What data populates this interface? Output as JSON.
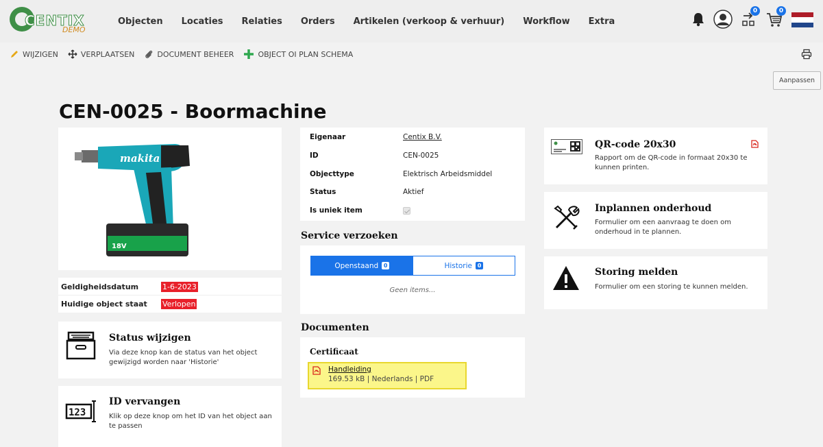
{
  "nav": {
    "logo_text": "CENTIX",
    "logo_sub": "DEMO",
    "menu": [
      "Objecten",
      "Locaties",
      "Relaties",
      "Orders",
      "Artikelen (verkoop & verhuur)",
      "Workflow",
      "Extra"
    ],
    "scan_count": "0",
    "cart_count": "0"
  },
  "toolbar": {
    "edit": "WIJZIGEN",
    "move": "VERPLAATSEN",
    "docs": "DOCUMENT BEHEER",
    "plan": "OBJECT OI PLAN SCHEMA",
    "customize": "Aanpassen"
  },
  "object": {
    "title": "CEN-0025 - Boormachine",
    "photo_brand": "makita",
    "battery_label": "18V",
    "properties": [
      {
        "label": "Eigenaar",
        "value": "Centix B.V."
      },
      {
        "label": "ID",
        "value": "CEN-0025"
      },
      {
        "label": "Objecttype",
        "value": "Elektrisch Arbeidsmiddel"
      },
      {
        "label": "Status",
        "value": "Aktief"
      },
      {
        "label": "Is uniek item",
        "value": ""
      }
    ],
    "validity": [
      {
        "label": "Geldigheidsdatum",
        "value": "1-6-2023"
      },
      {
        "label": "Huidige object staat",
        "value": "Verlopen"
      }
    ]
  },
  "actions": {
    "status_change": {
      "title": "Status wijzigen",
      "desc": "Via deze knop kan de status van het object gewijzigd worden naar 'Historie'"
    },
    "id_replace": {
      "title": "ID vervangen",
      "desc": "Klik op deze knop om het ID van het object aan te passen",
      "icon_text": "123"
    },
    "qr": {
      "title": "QR-code 20x30",
      "desc": "Rapport om de QR-code in formaat 20x30 te kunnen printen."
    },
    "maintenance": {
      "title": "Inplannen onderhoud",
      "desc": "Formulier om een aanvraag te doen om onderhoud in te plannen."
    },
    "fault": {
      "title": "Storing melden",
      "desc": "Formulier om een storing te kunnen melden."
    }
  },
  "service": {
    "heading": "Service verzoeken",
    "tab_open": "Openstaand",
    "tab_open_count": "0",
    "tab_history": "Historie",
    "tab_history_count": "0",
    "empty": "Geen items..."
  },
  "documents": {
    "heading": "Documenten",
    "category": "Certificaat",
    "file_name": "Handleiding",
    "file_meta": "169.53 kB | Nederlands | PDF"
  },
  "colors": {
    "accent": "#1a73e8",
    "danger": "#e8202a",
    "highlight": "#fbf68a",
    "brand_green": "#3f8f47"
  }
}
